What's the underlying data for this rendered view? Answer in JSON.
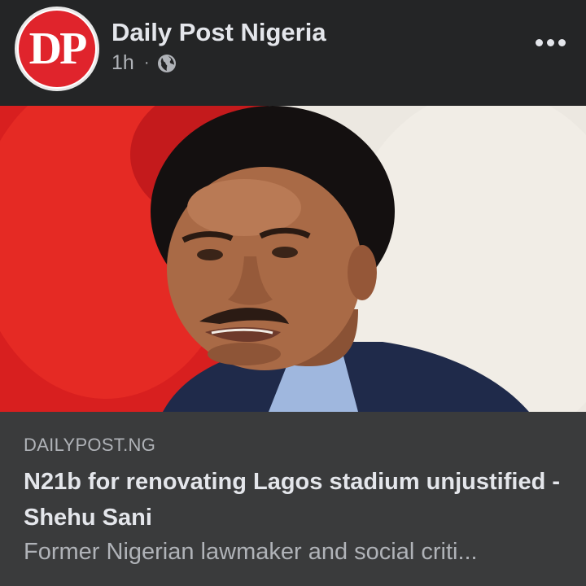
{
  "post": {
    "page_name": "Daily Post Nigeria",
    "avatar_text": "DP",
    "time": "1h",
    "separator": "·",
    "privacy_icon": "globe-icon",
    "more_icon": "more-horizontal-icon"
  },
  "link_preview": {
    "domain": "DAILYPOST.NG",
    "title": "N21b for renovating Lagos stadium unjustified - Shehu Sani",
    "description": "Former Nigerian lawmaker and social criti..."
  },
  "colors": {
    "background": "#242526",
    "preview_background": "#3a3b3c",
    "brand_red": "#e0242c",
    "primary_text": "#e4e6eb",
    "secondary_text": "#b0b3b8"
  }
}
